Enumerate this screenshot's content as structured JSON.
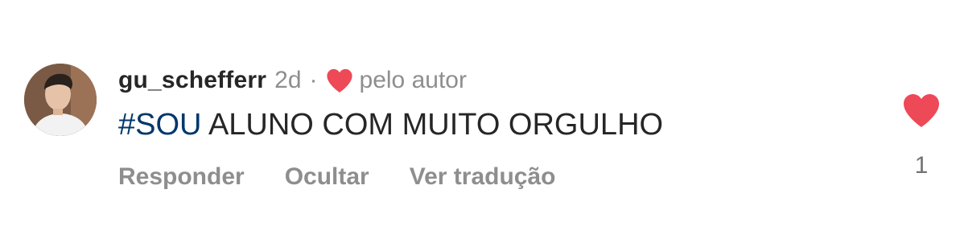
{
  "comment": {
    "username": "gu_schefferr",
    "timestamp": "2d",
    "separator": "·",
    "liked_by_author_label": "pelo autor",
    "hashtag": "#SOU",
    "body": " ALUNO COM MUITO ORGULHO",
    "actions": {
      "reply": "Responder",
      "hide": "Ocultar",
      "translate": "Ver tradução"
    },
    "like_count": "1"
  },
  "colors": {
    "heart": "#ed4956",
    "hashtag": "#00376b",
    "secondary_text": "#8e8e8e",
    "primary_text": "#262626"
  },
  "icons": {
    "author_like": "heart-icon",
    "like": "heart-icon"
  }
}
